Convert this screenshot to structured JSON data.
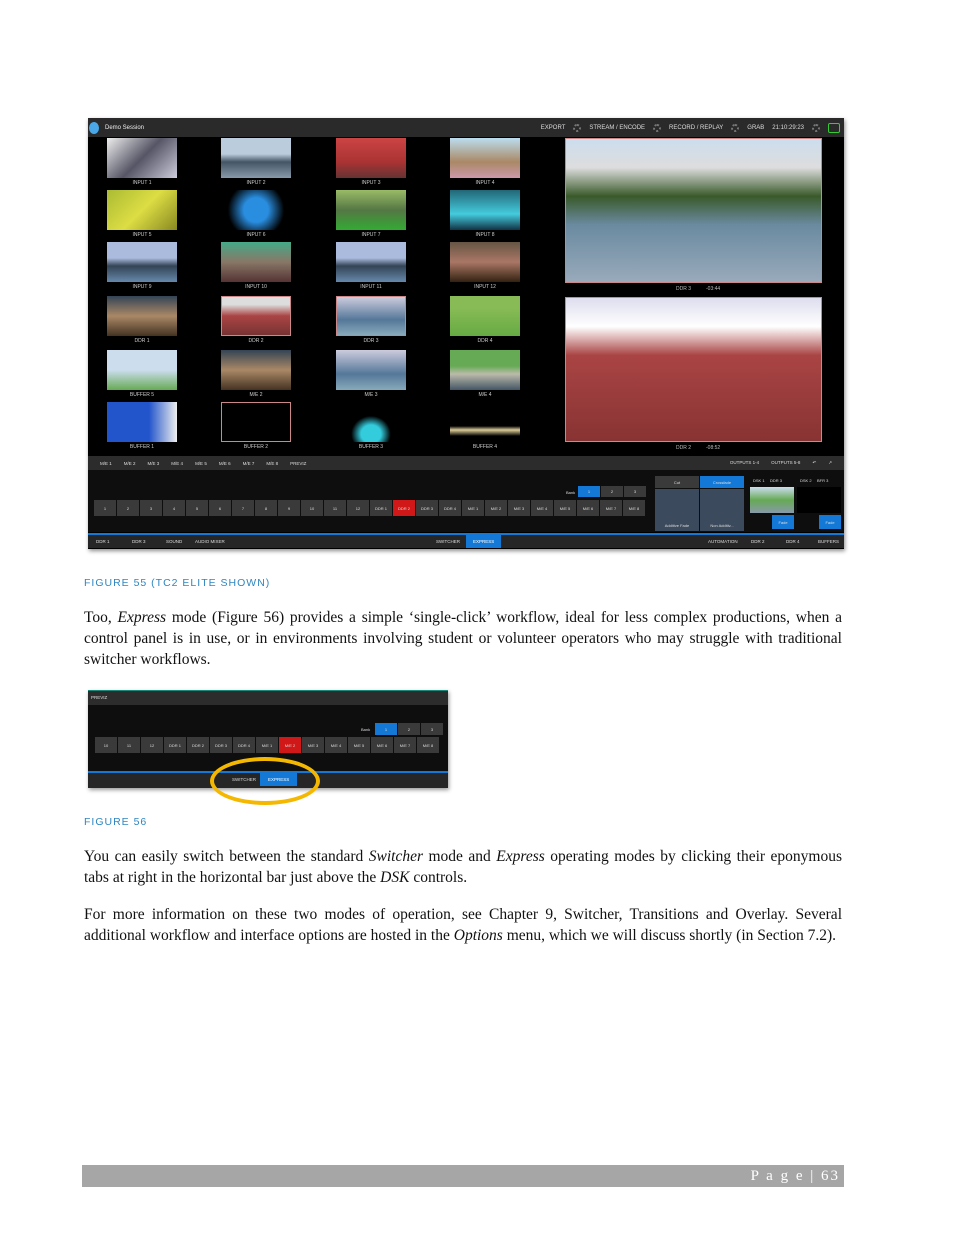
{
  "figure55": {
    "titlebar": {
      "title": "Demo Session",
      "items": [
        "EXPORT",
        "STREAM / ENCODE",
        "RECORD / REPLAY",
        "GRAB"
      ],
      "clock": "21:10:29:23"
    },
    "tiles": [
      "INPUT 1",
      "INPUT 2",
      "INPUT 3",
      "INPUT 4",
      "INPUT 5",
      "INPUT 6",
      "INPUT 7",
      "INPUT 8",
      "INPUT 9",
      "INPUT 10",
      "INPUT 11",
      "INPUT 12",
      "DDR 1",
      "DDR 2",
      "DDR 3",
      "DDR 4",
      "BUFFER 5",
      "M/E 2",
      "M/E 3",
      "M/E 4",
      "BUFFER 1",
      "BUFFER 2",
      "BUFFER 3",
      "BUFFER 4"
    ],
    "monitors": [
      {
        "label": "DDR 3",
        "time": "-03:44"
      },
      {
        "label": "DDR 2",
        "time": "-08:52"
      }
    ],
    "me_tabs": [
      "M/E 1",
      "M/E 2",
      "M/E 3",
      "M/E 4",
      "M/E 5",
      "M/E 6",
      "M/E 7",
      "M/E 8",
      "PREVIZ"
    ],
    "output_tabs": [
      "OUTPUTS 1-4",
      "OUTPUTS 5-8"
    ],
    "bank_label": "Bank",
    "banks": [
      "1",
      "2",
      "3"
    ],
    "row_buttons": [
      "1",
      "2",
      "3",
      "4",
      "5",
      "6",
      "7",
      "8",
      "9",
      "10",
      "11",
      "12",
      "DDR 1",
      "DDR 2",
      "DDR 3",
      "DDR 4",
      "M/E 1",
      "M/E 2",
      "M/E 3",
      "M/E 4",
      "M/E 5",
      "M/E 6",
      "M/E 7",
      "M/E 8"
    ],
    "selected": "DDR 2",
    "transition": {
      "cut": "Cut",
      "crossfade": "Crossfade",
      "additive": "Additive Fade",
      "non_additive": "Non Additiv..."
    },
    "dsk": [
      {
        "name": "DSK 1",
        "source": "DDR 3",
        "fade": "Fade"
      },
      {
        "name": "DSK 2",
        "source": "BFR 3",
        "fade": "Fade"
      }
    ],
    "bottom_left": [
      "DDR 1",
      "DDR 3",
      "SOUND",
      "AUDIO MIXER"
    ],
    "bottom_center": [
      "SWITCHER",
      "EXPRESS"
    ],
    "bottom_right": [
      "AUTOMATION",
      "DDR 2",
      "DDR 4",
      "BUFFERS"
    ],
    "accent": "#1479d6",
    "program_red": "#d01818"
  },
  "caption55": "FIGURE 55 (TC2 ELITE SHOWN)",
  "para1": [
    {
      "t": "Too, "
    },
    {
      "t": "Express",
      "i": true
    },
    {
      "t": " mode (Figure 56) provides a simple ‘single-click’ workflow, ideal for less complex productions, when a control panel is in use, or in environments involving student or volunteer operators who may struggle with traditional switcher workflows."
    }
  ],
  "figure56": {
    "tab": "PREVIZ",
    "bank_label": "Bank",
    "banks": [
      "1",
      "2",
      "3"
    ],
    "row_buttons": [
      "10",
      "11",
      "12",
      "DDR 1",
      "DDR 2",
      "DDR 3",
      "DDR 4",
      "M/E 1",
      "M/E 2",
      "M/E 3",
      "M/E 4",
      "M/E 5",
      "M/E 6",
      "M/E 7",
      "M/E 8"
    ],
    "selected": "M/E 2",
    "bottom": [
      "SWITCHER",
      "EXPRESS"
    ],
    "highlight_color": "#f5b800"
  },
  "caption56": "FIGURE 56",
  "para2": [
    {
      "t": "You can easily switch between the standard "
    },
    {
      "t": "Switcher",
      "i": true
    },
    {
      "t": " mode and "
    },
    {
      "t": "Express",
      "i": true
    },
    {
      "t": " operating modes by clicking their eponymous tabs at right in the horizontal bar just above the "
    },
    {
      "t": "DSK",
      "i": true
    },
    {
      "t": " controls."
    }
  ],
  "para3": [
    {
      "t": "For more information on these two modes of operation, see Chapter 9, Switcher, Transitions and Overlay. Several additional workflow and interface options are hosted in the "
    },
    {
      "t": "Options",
      "i": true
    },
    {
      "t": " menu, which we will discuss shortly (in Section 7.2)."
    }
  ],
  "footer": "P a g e  | 63"
}
